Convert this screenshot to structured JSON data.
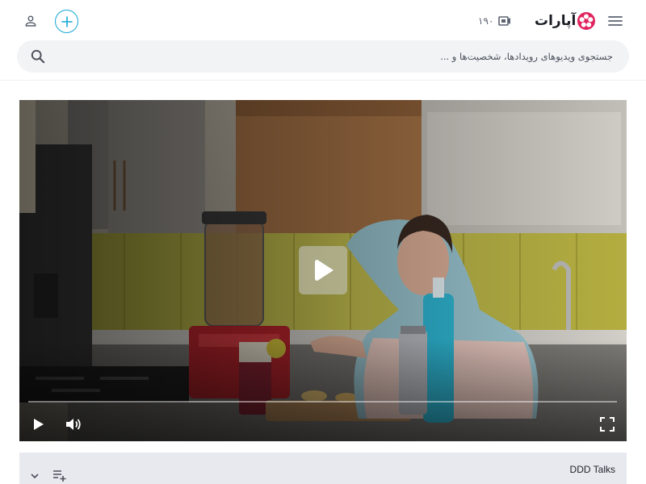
{
  "header": {
    "logo_text": "آپارات",
    "upload_count": "۱۹۰"
  },
  "search": {
    "placeholder": "جستجوی ویدیوهای رویدادها، شخصیت‌ها و ..."
  },
  "player": {
    "progress": 0
  },
  "below_player": {
    "channel_name": "DDD Talks"
  },
  "colors": {
    "accent": "#17a8d6",
    "logo_red": "#e0245e",
    "player_bg": "#2a2a28"
  },
  "icons": [
    "user-icon",
    "add-icon",
    "menu-icon",
    "aparat-logo-icon",
    "video-camera-icon",
    "search-icon",
    "play-icon",
    "volume-icon",
    "fullscreen-icon",
    "chevron-down-icon",
    "add-to-playlist-icon"
  ]
}
